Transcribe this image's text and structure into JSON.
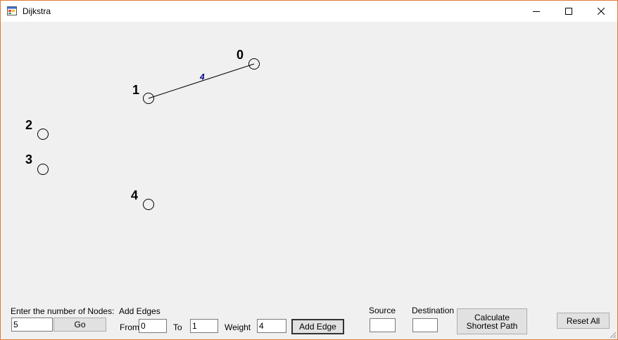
{
  "window": {
    "title": "Dijkstra",
    "icon": "winforms-app-icon",
    "controls": [
      "minimize-icon",
      "maximize-icon",
      "close-icon"
    ]
  },
  "graph": {
    "nodes": [
      {
        "id": "0"
      },
      {
        "id": "1"
      },
      {
        "id": "2"
      },
      {
        "id": "3"
      },
      {
        "id": "4"
      }
    ],
    "edges": [
      {
        "from": "1",
        "to": "0",
        "weight": "4"
      }
    ],
    "edge_label_color": "#00008b"
  },
  "controls": {
    "nodes_label": "Enter the number of Nodes:",
    "nodes_value": "5",
    "go_button": "Go",
    "add_edges_label": "Add Edges",
    "from_label": "From",
    "from_value": "0",
    "to_label": "To",
    "to_value": "1",
    "weight_label": "Weight",
    "weight_value": "4",
    "add_edge_button": "Add Edge",
    "source_label": "Source",
    "source_value": "",
    "destination_label": "Destination",
    "destination_value": "",
    "calculate_button_line1": "Calculate",
    "calculate_button_line2": "Shortest Path",
    "reset_button": "Reset All"
  }
}
